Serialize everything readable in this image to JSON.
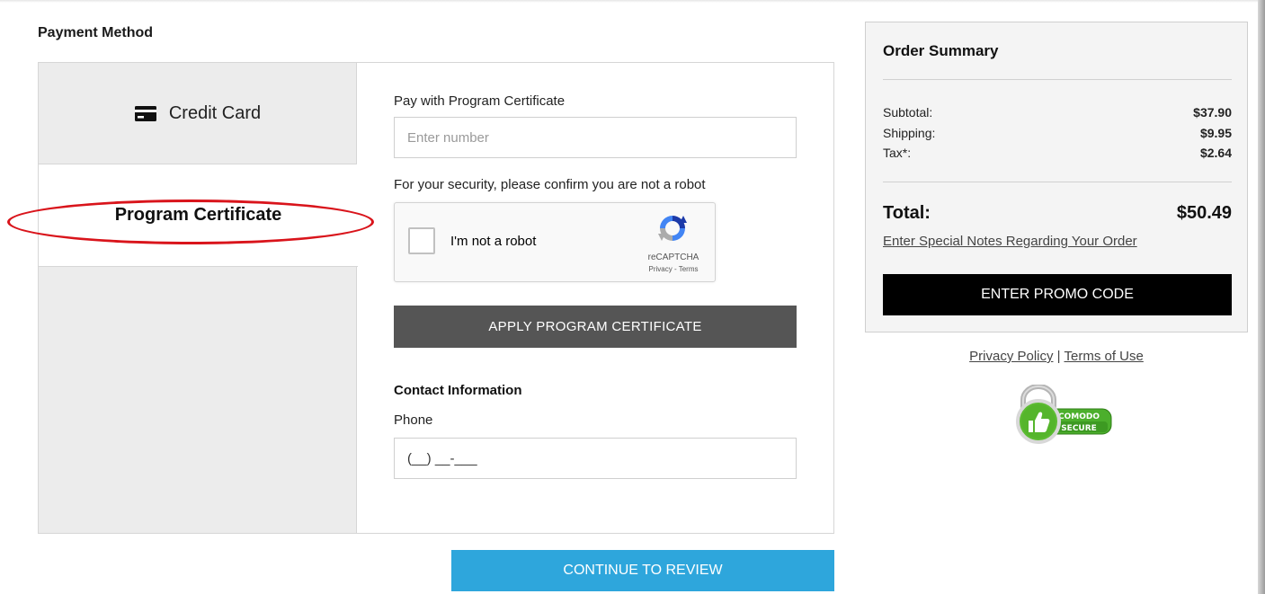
{
  "payment": {
    "section_title": "Payment Method",
    "methods": [
      {
        "label": "Credit Card",
        "icon": "credit-card-icon"
      },
      {
        "label": "Program Certificate"
      }
    ],
    "certificate": {
      "label": "Pay with Program Certificate",
      "placeholder": "Enter number",
      "value": ""
    },
    "security_text": "For your security, please confirm you are not a robot",
    "recaptcha": {
      "checkbox_label": "I'm not a robot",
      "brand": "reCAPTCHA",
      "links": "Privacy - Terms"
    },
    "apply_label": "APPLY PROGRAM CERTIFICATE",
    "contact": {
      "title": "Contact Information",
      "phone_label": "Phone",
      "phone_value": "(__) __-___"
    },
    "continue_label": "CONTINUE TO REVIEW"
  },
  "summary": {
    "title": "Order Summary",
    "rows": [
      {
        "label": "Subtotal:",
        "value": "$37.90"
      },
      {
        "label": "Shipping:",
        "value": "$9.95"
      },
      {
        "label": "Tax*:",
        "value": "$2.64"
      }
    ],
    "total_label": "Total:",
    "total_value": "$50.49",
    "notes_link": "Enter Special Notes Regarding Your Order",
    "promo_label": "ENTER PROMO CODE"
  },
  "footer": {
    "privacy": "Privacy Policy",
    "separator": "|",
    "terms": "Terms of Use"
  },
  "badge": {
    "top": "COMODO",
    "bottom": "SECURE"
  },
  "colors": {
    "continue": "#2ea6dc",
    "apply": "#555555",
    "promo": "#000000",
    "annotation": "#d9141b",
    "badge_green": "#4caf2c"
  }
}
